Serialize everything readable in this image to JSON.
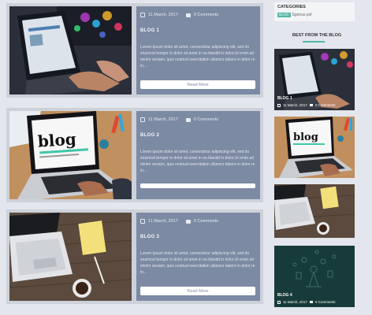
{
  "posts": [
    {
      "date": "11 March, 2017",
      "comments": "0 Comments",
      "title": "BLOG 1",
      "excerpt": "Lorem ipsum dolor sit amet, consectetur adipiscing elit, sed do eiusmod tempor in dolor sit amet in ea blandit in dolor.Ut enim ad minim veniam, quis nostrud exercitation ullamco labore in dolor re in...",
      "read_more": "Read More"
    },
    {
      "date": "11 March, 2017",
      "comments": "0 Comments",
      "title": "BLOG 2",
      "excerpt": "Lorem ipsum dolor sit amet, consectetur adipiscing elit, sed do eiusmod tempor in dolor sit amet in ea blandit in dolor.Ut enim ad minim veniam, quis nostrud exercitation ullamco labore in dolor re in...",
      "read_more": ""
    },
    {
      "date": "11 March, 2017",
      "comments": "0 Comments",
      "title": "BLOG 3",
      "excerpt": "Lorem ipsum dolor sit amet, consectetur adipiscing elit, sed do eiusmod tempor in dolor sit amet in ea blandit in dolor.Ut enim ad minim veniam, quis nostrud exercitation ullamco labore in dolor re in...",
      "read_more": "Read More"
    }
  ],
  "sidebar": {
    "categories_title": "CATEGORIES",
    "categories_tag": "BLOG",
    "categories_item": "Sgonus psf",
    "best_title": "BEST FROM THE BLOG",
    "side_posts": [
      {
        "title": "BLOG 1",
        "date": "11 March, 2017",
        "comments": "0 Comments"
      },
      {
        "title": "",
        "date": "",
        "comments": ""
      },
      {
        "title": "",
        "date": "",
        "comments": ""
      },
      {
        "title": "BLOG 4",
        "date": "11 March, 2017",
        "comments": "0 Comments"
      }
    ]
  },
  "colors": {
    "card": "#7d8aa4",
    "accent": "#52b7a8",
    "background": "#e3e6ec"
  },
  "icons": [
    "calendar-icon",
    "comment-icon"
  ]
}
